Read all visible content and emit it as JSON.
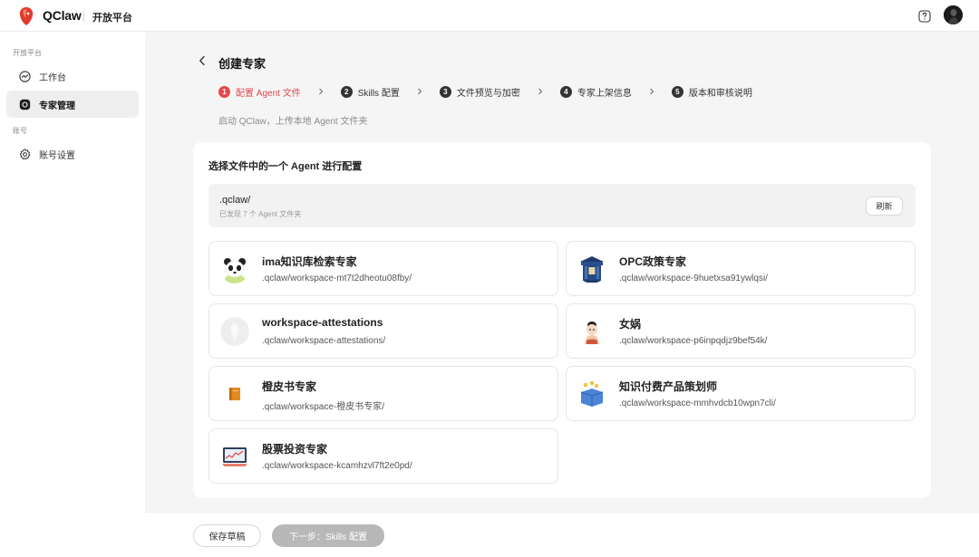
{
  "header": {
    "brand": "QClaw",
    "subtitle": "开放平台",
    "help_icon": "question-icon",
    "avatar_icon": "user-avatar"
  },
  "sidebar": {
    "groups": [
      {
        "label": "开放平台",
        "items": [
          {
            "label": "工作台",
            "icon": "dashboard-icon",
            "active": false
          },
          {
            "label": "专家管理",
            "icon": "agent-icon",
            "active": true
          }
        ]
      },
      {
        "label": "账号",
        "items": [
          {
            "label": "账号设置",
            "icon": "gear-icon",
            "active": false
          }
        ]
      }
    ]
  },
  "page": {
    "back_icon": "chevron-left-icon",
    "title": "创建专家",
    "subtitle": "启动 QClaw，上传本地 Agent 文件夹"
  },
  "steps": [
    {
      "num": "1",
      "label": "配置 Agent 文件",
      "active": true
    },
    {
      "num": "2",
      "label": "Skills 配置",
      "active": false
    },
    {
      "num": "3",
      "label": "文件预览与加密",
      "active": false
    },
    {
      "num": "4",
      "label": "专家上架信息",
      "active": false
    },
    {
      "num": "5",
      "label": "版本和审核说明",
      "active": false
    }
  ],
  "selector": {
    "title": "选择文件中的一个 Agent 进行配置",
    "folder": ".qclaw/",
    "count_text": "已发现 7 个 Agent 文件夹",
    "refresh_label": "刷新"
  },
  "agents": [
    {
      "name": "ima知识库检索专家",
      "path": ".qclaw/workspace-mt7t2dheotu08fby/",
      "icon": "panda-icon"
    },
    {
      "name": "OPC政策专家",
      "path": ".qclaw/workspace-9huetxsa91ywlqsi/",
      "icon": "government-building-icon"
    },
    {
      "name": "workspace-attestations",
      "path": ".qclaw/workspace-attestations/",
      "icon": "default-agent-icon"
    },
    {
      "name": "女娲",
      "path": ".qclaw/workspace-p6inpqdjz9bef54k/",
      "icon": "character-icon"
    },
    {
      "name": "橙皮书专家",
      "path": ".qclaw/workspace-橙皮书专家/",
      "icon": "orange-book-icon"
    },
    {
      "name": "知识付费产品策划师",
      "path": ".qclaw/workspace-mmhvdcb10wpn7cli/",
      "icon": "knowledge-box-icon"
    },
    {
      "name": "股票投资专家",
      "path": ".qclaw/workspace-kcamhzvl7ft2e0pd/",
      "icon": "stock-chart-icon"
    }
  ],
  "footer": {
    "draft_label": "保存草稿",
    "next_label": "下一步：Skills 配置"
  }
}
